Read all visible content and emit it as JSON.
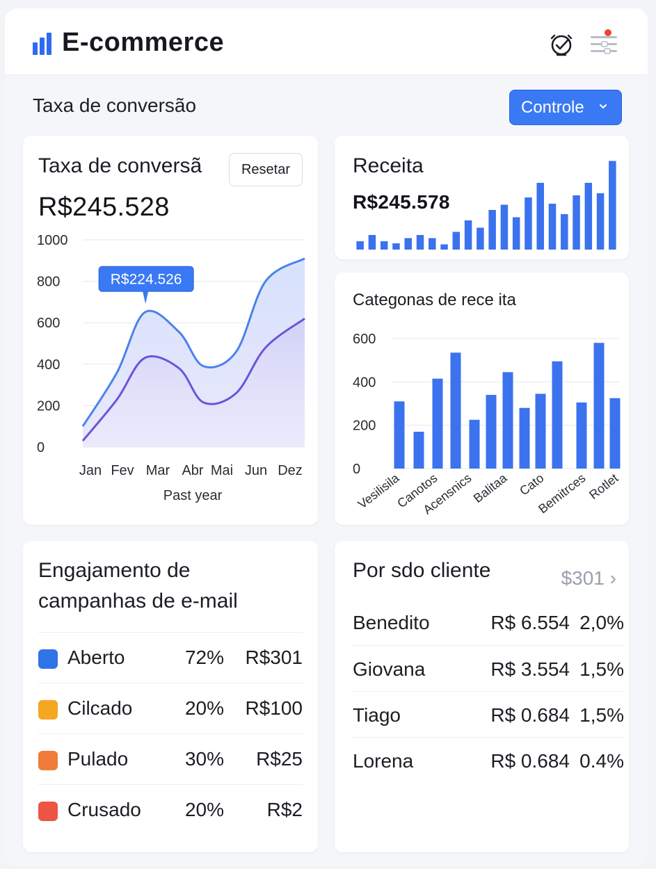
{
  "header": {
    "title": "E-commerce",
    "clock_icon": "stopwatch-icon",
    "menu_icon": "settings-menu-icon",
    "notification_color": "#f0443a"
  },
  "section": {
    "title": "Taxa de conversão",
    "dropdown_label": "Controle"
  },
  "conversion_card": {
    "title": "Taxa de conversã",
    "reset_label": "Resetar",
    "value": "R$245.528",
    "tooltip": "R$224.526",
    "xlabel": "Past year"
  },
  "revenue_card": {
    "title": "Receita",
    "value": "R$245.578"
  },
  "categories_card": {
    "title": "Categonas de rece ita"
  },
  "email_card": {
    "title_line1": "Engajamento de",
    "title_line2": "campanhas de e-mail",
    "rows": [
      {
        "label": "Aberto",
        "pct": "72%",
        "amount": "R$301",
        "icon": "envelope-icon",
        "color": "#2f74e8"
      },
      {
        "label": "Cilcado",
        "pct": "20%",
        "amount": "R$100",
        "icon": "cursor-icon",
        "color": "#f5a623"
      },
      {
        "label": "Pulado",
        "pct": "30%",
        "amount": "R$25",
        "icon": "skip-icon",
        "color": "#f27b3a"
      },
      {
        "label": "Crusado",
        "pct": "20%",
        "amount": "R$2",
        "icon": "cross-icon",
        "color": "#ee5444"
      }
    ]
  },
  "clients_card": {
    "title": "Por sdo cliente",
    "more_label": "$301 ›",
    "rows": [
      {
        "name": "Benedito",
        "value": "R$ 6.554",
        "pct": "2,0%"
      },
      {
        "name": "Giovana",
        "value": "R$ 3.554",
        "pct": "1,5%"
      },
      {
        "name": "Tiago",
        "value": "R$ 0.684",
        "pct": "1,5%"
      },
      {
        "name": "Lorena",
        "value": "R$ 0.684",
        "pct": "0.4%"
      }
    ]
  },
  "chart_data": [
    {
      "type": "area",
      "title": "",
      "xlabel": "Past year",
      "ylabel": "",
      "categories": [
        "Jan",
        "Fev",
        "Mar",
        "Abr",
        "Mai",
        "Jun",
        "Dez"
      ],
      "x": [
        0,
        2.1,
        3.8,
        5.9,
        7.4,
        9.4,
        11.2,
        13.6
      ],
      "ylim": [
        0,
        1000
      ],
      "yticks": [
        0,
        200,
        400,
        600,
        800,
        1000
      ],
      "series": [
        {
          "values": [
            100,
            360,
            650,
            555,
            390,
            460,
            800,
            910
          ],
          "color": "#4a82ec"
        },
        {
          "values": [
            30,
            230,
            430,
            380,
            215,
            260,
            480,
            620
          ],
          "color": "#6a55d8"
        }
      ],
      "grid": true
    },
    {
      "type": "bar",
      "title": "",
      "values": [
        8,
        14,
        8,
        6,
        11,
        14,
        11,
        5,
        17,
        28,
        21,
        38,
        43,
        31,
        50,
        64,
        44,
        34,
        52,
        64,
        54,
        85
      ],
      "ylim": [
        0,
        90
      ],
      "color": "#3b72ee"
    },
    {
      "type": "bar",
      "title": "",
      "categories": [
        "Vesilisila",
        "Canotos",
        "Acensnics",
        "Balitaa",
        "Cato",
        "Bemitrces",
        "Rotlet"
      ],
      "values": [
        310,
        170,
        415,
        535,
        225,
        340,
        445,
        280,
        345,
        495,
        305,
        580,
        325
      ],
      "ylim": [
        0,
        600
      ],
      "yticks": [
        0,
        200,
        400,
        600
      ],
      "color": "#3b72ee",
      "grid": true
    }
  ]
}
